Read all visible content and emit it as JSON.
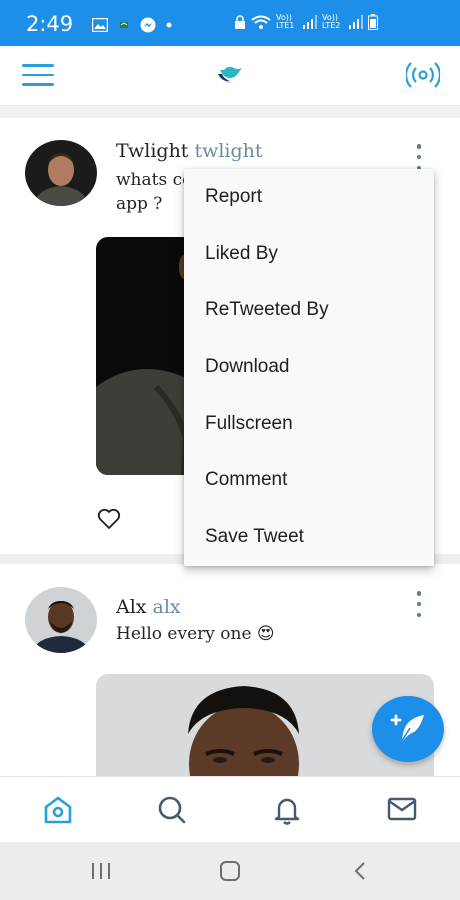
{
  "status_bar": {
    "time": "2:49",
    "net1": "Vo)) LTE1",
    "net2": "Vo)) LTE2"
  },
  "app_bar": {
    "menu_icon": "hamburger-icon",
    "logo_icon": "bird-logo-icon",
    "live_icon": "broadcast-icon",
    "accent": "#2a9fd6"
  },
  "tweets": [
    {
      "name": "Twlight",
      "handle": "twlight",
      "text_line1": "whats co",
      "text_line2": "app ?"
    },
    {
      "name": "Alx",
      "handle": "alx",
      "text": "Hello every one",
      "emoji": "😍"
    }
  ],
  "menu": {
    "items": [
      "Report",
      "Liked By",
      "ReTweeted By",
      "Download",
      "Fullscreen",
      "Comment",
      "Save Tweet"
    ]
  },
  "bottom_nav": {
    "items": [
      "home-icon",
      "search-icon",
      "bell-icon",
      "mail-icon"
    ]
  },
  "colors": {
    "primary": "#1d8fe8",
    "handle": "#6c8aa3"
  }
}
